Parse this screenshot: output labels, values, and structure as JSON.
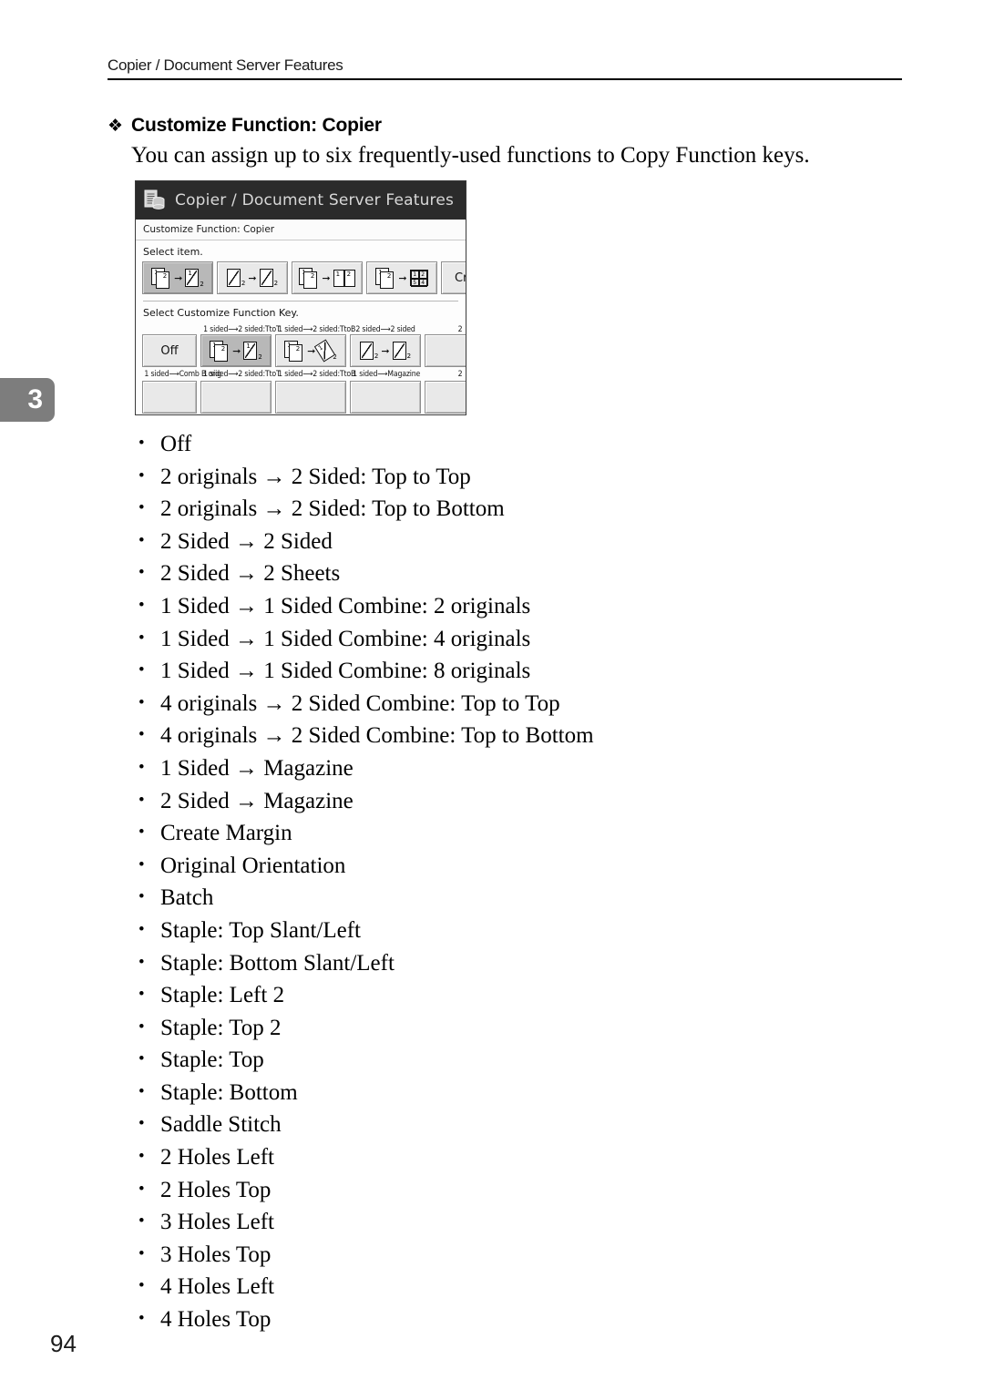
{
  "header": {
    "running_head": "Copier / Document Server Features"
  },
  "chapter_tab": {
    "number": "3",
    "color": "#7d7d7d"
  },
  "section": {
    "bullet_glyph": "❖",
    "title": "Customize Function: Copier",
    "intro": "You can assign up to six frequently-used functions to Copy Function keys."
  },
  "device_screenshot": {
    "title_bar": {
      "icon": "document-server-icon",
      "title": "Copier / Document Server Features"
    },
    "breadcrumb": "Customize Function: Copier",
    "prompt_item": "Select item.",
    "prompt_key": "Select Customize Function Key.",
    "item_keys": [
      {
        "name": "1-sided-to-2-sided-ttot",
        "selected": true
      },
      {
        "name": "2-sided-to-2-sided",
        "selected": false
      },
      {
        "name": "1-sided-to-1-sided-combine-2",
        "selected": false
      },
      {
        "name": "1-sided-to-1-sided-combine-4",
        "selected": false
      },
      {
        "name": "create-margin",
        "label": "Crea",
        "selected": false
      }
    ],
    "function_key_labels_row1": [
      "1 sided⟶2 sided:TtoT",
      "1 sided⟶2 sided:TtoB",
      "2 sided⟶2 sided",
      "2"
    ],
    "off_key_label": "Off",
    "function_keys_row1": [
      {
        "name": "key-1sided-2sided-ttot",
        "selected": true
      },
      {
        "name": "key-1sided-2sided-ttob",
        "selected": false
      },
      {
        "name": "key-2sided-2sided",
        "selected": false
      },
      {
        "name": "key-partial",
        "selected": false
      }
    ],
    "function_key_labels_row2": [
      "1 sided⟶Comb B orig",
      "1 sided⟶2 sided:TtoT",
      "1 sided⟶2 sided:TtoB",
      "1 sided⟶Magazine",
      "2"
    ]
  },
  "features": [
    "Off",
    "2 originals → 2 Sided: Top to Top",
    "2 originals → 2 Sided: Top to Bottom",
    "2 Sided → 2 Sided",
    "2 Sided → 2 Sheets",
    "1 Sided → 1 Sided Combine: 2 originals",
    "1 Sided → 1 Sided Combine: 4 originals",
    "1 Sided → 1 Sided Combine: 8 originals",
    "4 originals → 2 Sided Combine: Top to Top",
    "4 originals → 2 Sided Combine: Top to Bottom",
    "1 Sided → Magazine",
    "2 Sided → Magazine",
    "Create Margin",
    "Original Orientation",
    "Batch",
    "Staple: Top Slant/Left",
    "Staple: Bottom Slant/Left",
    "Staple: Left 2",
    "Staple: Top 2",
    "Staple: Top",
    "Staple: Bottom",
    "Saddle Stitch",
    "2 Holes Left",
    "2 Holes Top",
    "3 Holes Left",
    "3 Holes Top",
    "4 Holes Left",
    "4 Holes Top"
  ],
  "page_number": "94"
}
